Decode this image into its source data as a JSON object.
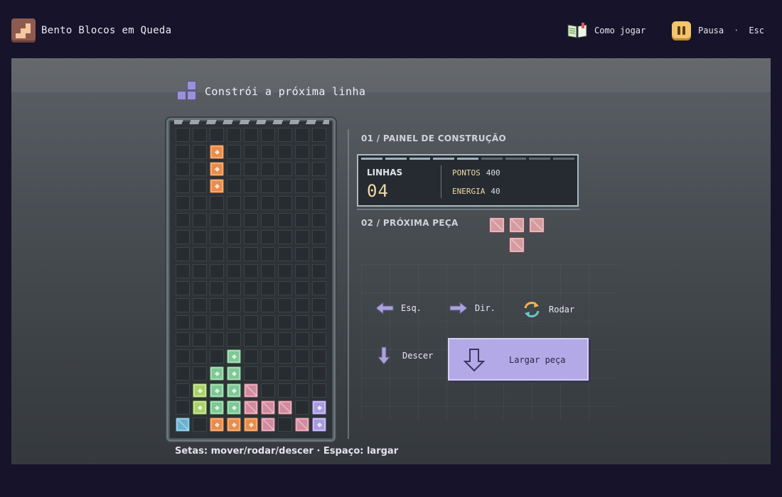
{
  "app": {
    "title": "Bento Blocos em Queda"
  },
  "header": {
    "help_label": "Como jogar",
    "pause_label": "Pausa",
    "separator": "·",
    "esc_label": "Esc"
  },
  "main": {
    "heading": "Constrói a próxima linha",
    "hint": "Setas: mover/rodar/descer · Espaço: largar"
  },
  "panel": {
    "section1": "01 / PAINEL DE CONSTRUÇÃO",
    "lines_label": "LINHAS",
    "lines_value": "04",
    "points_label": "PONTOS",
    "points_value": "400",
    "energy_label": "ENERGIA",
    "energy_value": "40",
    "section2": "02 / PRÓXIMA PEÇA"
  },
  "controls": {
    "left": "Esq.",
    "right": "Dir.",
    "rotate": "Rodar",
    "down": "Descer",
    "drop": "Largar peça"
  },
  "board": {
    "cols": 9,
    "rows": 18,
    "blocks": [
      {
        "c": 2,
        "r": 1,
        "color": "orange",
        "style": "gem"
      },
      {
        "c": 2,
        "r": 2,
        "color": "orange",
        "style": "gem"
      },
      {
        "c": 2,
        "r": 3,
        "color": "orange",
        "style": "gem"
      },
      {
        "c": 3,
        "r": 13,
        "color": "green",
        "style": "gem"
      },
      {
        "c": 2,
        "r": 14,
        "color": "green",
        "style": "gem"
      },
      {
        "c": 3,
        "r": 14,
        "color": "green",
        "style": "gem"
      },
      {
        "c": 1,
        "r": 15,
        "color": "lime",
        "style": "gem"
      },
      {
        "c": 2,
        "r": 15,
        "color": "green",
        "style": "gem"
      },
      {
        "c": 3,
        "r": 15,
        "color": "green",
        "style": "gem"
      },
      {
        "c": 4,
        "r": 15,
        "color": "pink",
        "style": "slash"
      },
      {
        "c": 1,
        "r": 16,
        "color": "lime",
        "style": "gem"
      },
      {
        "c": 2,
        "r": 16,
        "color": "green",
        "style": "gem"
      },
      {
        "c": 3,
        "r": 16,
        "color": "green",
        "style": "gem"
      },
      {
        "c": 4,
        "r": 16,
        "color": "pink",
        "style": "slash"
      },
      {
        "c": 5,
        "r": 16,
        "color": "pink",
        "style": "slash"
      },
      {
        "c": 6,
        "r": 16,
        "color": "pink",
        "style": "slash"
      },
      {
        "c": 8,
        "r": 16,
        "color": "purple",
        "style": "gem"
      },
      {
        "c": 0,
        "r": 17,
        "color": "blue",
        "style": "slash"
      },
      {
        "c": 2,
        "r": 17,
        "color": "orange",
        "style": "gem"
      },
      {
        "c": 3,
        "r": 17,
        "color": "orange",
        "style": "gem"
      },
      {
        "c": 4,
        "r": 17,
        "color": "orange",
        "style": "gem"
      },
      {
        "c": 5,
        "r": 17,
        "color": "pink",
        "style": "slash"
      },
      {
        "c": 7,
        "r": 17,
        "color": "pink",
        "style": "slash"
      },
      {
        "c": 8,
        "r": 17,
        "color": "purple",
        "style": "gem"
      }
    ]
  },
  "next_piece": {
    "color": "#d49a9f",
    "cells": [
      {
        "c": 0,
        "r": 0
      },
      {
        "c": 1,
        "r": 0
      },
      {
        "c": 2,
        "r": 0
      },
      {
        "c": 1,
        "r": 1
      }
    ]
  },
  "colors": {
    "background": "#16132b",
    "accent": "#b3a9e6",
    "score_text": "#f0d9a8"
  }
}
